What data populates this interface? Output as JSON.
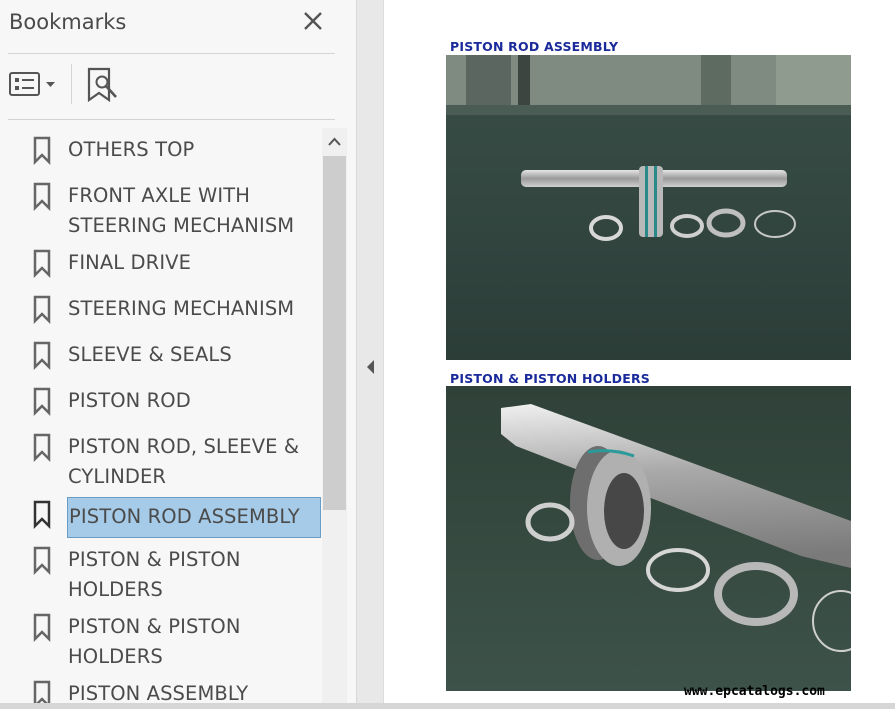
{
  "panel": {
    "title": "Bookmarks",
    "icons": {
      "close": "close-icon",
      "options": "bookmark-options-icon",
      "find": "find-current-bookmark-icon"
    },
    "items": [
      {
        "label": "OTHERS TOP",
        "line2": ""
      },
      {
        "label": "FRONT AXLE WITH",
        "line2": "STEERING MECHANISM"
      },
      {
        "label": "FINAL DRIVE",
        "line2": ""
      },
      {
        "label": "STEERING MECHANISM",
        "line2": ""
      },
      {
        "label": "SLEEVE & SEALS",
        "line2": ""
      },
      {
        "label": "PISTON ROD",
        "line2": ""
      },
      {
        "label": "PISTON ROD, SLEEVE &",
        "line2": "CYLINDER"
      },
      {
        "label": "PISTON ROD ASSEMBLY",
        "line2": "",
        "selected": true
      },
      {
        "label": "PISTON & PISTON",
        "line2": "HOLDERS"
      },
      {
        "label": "PISTON & PISTON",
        "line2": "HOLDERS"
      },
      {
        "label": "PISTON ASSEMBLY",
        "line2": ""
      }
    ]
  },
  "document": {
    "caption1": "PISTON ROD ASSEMBLY",
    "caption2": "PISTON & PISTON HOLDERS",
    "watermark": "www.epcatalogs.com"
  },
  "colors": {
    "selection": "#a6cbe8",
    "caption": "#1a2a9a",
    "panel_bg": "#f7f7f7"
  }
}
